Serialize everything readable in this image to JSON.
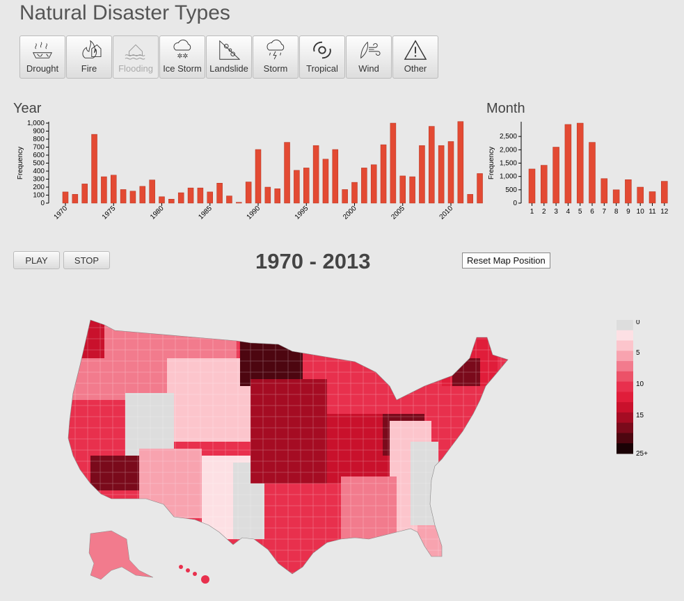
{
  "page": {
    "title": "Natural Disaster Types"
  },
  "toolbar": {
    "items": [
      {
        "label": "Drought",
        "icon": "drought-icon",
        "active": false
      },
      {
        "label": "Fire",
        "icon": "fire-icon",
        "active": false
      },
      {
        "label": "Flooding",
        "icon": "flooding-icon",
        "active": true
      },
      {
        "label": "Ice Storm",
        "icon": "ice-storm-icon",
        "active": false
      },
      {
        "label": "Landslide",
        "icon": "landslide-icon",
        "active": false
      },
      {
        "label": "Storm",
        "icon": "storm-icon",
        "active": false
      },
      {
        "label": "Tropical",
        "icon": "tropical-icon",
        "active": false
      },
      {
        "label": "Wind",
        "icon": "wind-icon",
        "active": false
      },
      {
        "label": "Other",
        "icon": "warning-icon",
        "active": false
      }
    ]
  },
  "controls": {
    "play": "PLAY",
    "stop": "STOP",
    "range": "1970 - 2013",
    "reset": "Reset Map Position"
  },
  "colors": {
    "bar": "#e34a33",
    "bar_stroke": "#b3301c",
    "title": "#555555"
  },
  "legend": {
    "labels": [
      "0",
      "5",
      "10",
      "15",
      "25+"
    ],
    "colors": [
      "#dddddd",
      "#fde0e4",
      "#fcc5cc",
      "#f8a3af",
      "#f27b8d",
      "#ec5268",
      "#e8304d",
      "#e01d3a",
      "#c9112c",
      "#a50c23",
      "#7a0a1b",
      "#4d0610",
      "#1a0205"
    ]
  },
  "chart_data": [
    {
      "type": "bar",
      "title": "Year",
      "ylabel": "Frequency",
      "xlabel": "",
      "x": [
        1970,
        1971,
        1972,
        1973,
        1974,
        1975,
        1976,
        1977,
        1978,
        1979,
        1980,
        1981,
        1982,
        1983,
        1984,
        1985,
        1986,
        1987,
        1988,
        1989,
        1990,
        1991,
        1992,
        1993,
        1994,
        1995,
        1996,
        1997,
        1998,
        1999,
        2000,
        2001,
        2002,
        2003,
        2004,
        2005,
        2006,
        2007,
        2008,
        2009,
        2010,
        2011,
        2012,
        2013
      ],
      "values": [
        140,
        110,
        240,
        860,
        330,
        350,
        170,
        150,
        210,
        290,
        80,
        50,
        130,
        190,
        190,
        140,
        250,
        90,
        10,
        265,
        670,
        200,
        180,
        760,
        410,
        440,
        720,
        550,
        670,
        170,
        260,
        440,
        480,
        730,
        1000,
        340,
        330,
        720,
        960,
        720,
        770,
        1020,
        110,
        370
      ],
      "xticks": [
        "1970",
        "1975",
        "1980",
        "1985",
        "1990",
        "1995",
        "2000",
        "2005",
        "2010"
      ],
      "yticks": [
        "0",
        "100",
        "200",
        "300",
        "400",
        "500",
        "600",
        "700",
        "800",
        "900",
        "1,000"
      ],
      "ylim": [
        0,
        1000
      ]
    },
    {
      "type": "bar",
      "title": "Month",
      "ylabel": "Frequency",
      "xlabel": "",
      "categories": [
        "1",
        "2",
        "3",
        "4",
        "5",
        "6",
        "7",
        "8",
        "9",
        "10",
        "11",
        "12"
      ],
      "values": [
        1280,
        1420,
        2100,
        2950,
        3000,
        2280,
        920,
        500,
        880,
        600,
        430,
        820
      ],
      "yticks": [
        "0",
        "500",
        "1,000",
        "1,500",
        "2,000",
        "2,500"
      ],
      "ylim": [
        0,
        3000
      ]
    }
  ]
}
